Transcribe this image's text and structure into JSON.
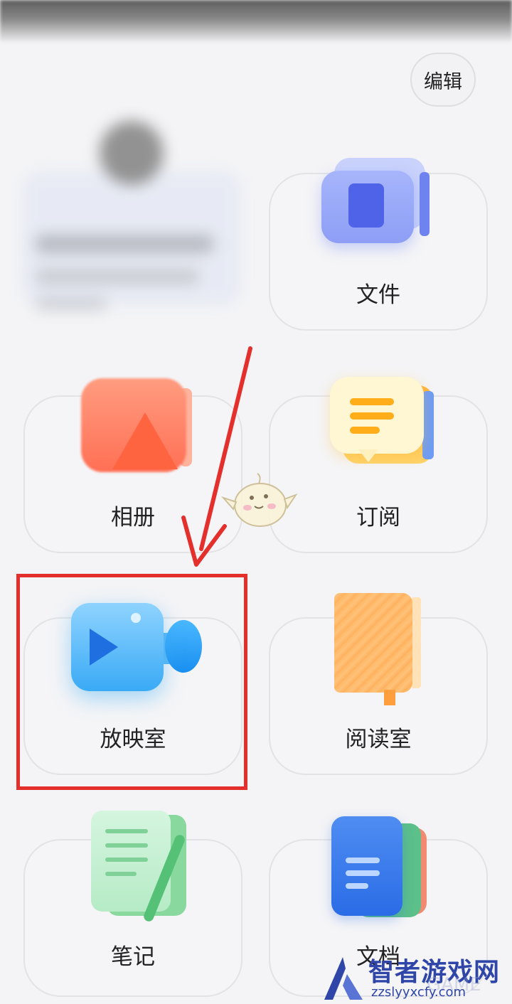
{
  "header": {
    "edit_label": "编辑"
  },
  "cards": {
    "files": "文件",
    "album": "相册",
    "subscriptions": "订阅",
    "cinema": "放映室",
    "reading_room": "阅读室",
    "notes": "笔记",
    "docs": "文档"
  },
  "watermark": {
    "brand": "智者游戏网",
    "ghost": "GAME",
    "url": "zzslyyxcfy.com"
  },
  "colors": {
    "highlight": "#e4302c",
    "watermark": "#2f46a8"
  },
  "icons": {
    "files": "folder-doc-icon",
    "album": "photo-album-icon",
    "subscriptions": "chat-bubble-icon",
    "cinema": "video-camera-icon",
    "reading_room": "book-icon",
    "notes": "notebook-pen-icon",
    "docs": "document-stack-icon"
  }
}
